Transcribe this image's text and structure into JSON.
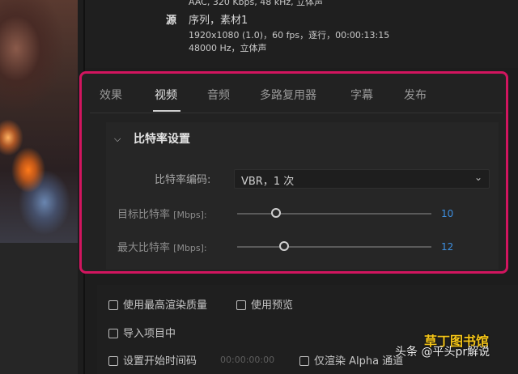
{
  "info": {
    "audio_top": "AAC, 320 Kbps, 48 kHz, 立体声",
    "source_prefix": "源",
    "source_name": "序列，素材1",
    "video_line": "1920x1080 (1.0)，60 fps，逐行，00:00:13:15",
    "audio_line": "48000 Hz，立体声"
  },
  "tabs": [
    {
      "label": "效果"
    },
    {
      "label": "视频"
    },
    {
      "label": "音频"
    },
    {
      "label": "多路复用器"
    },
    {
      "label": "字幕"
    },
    {
      "label": "发布"
    }
  ],
  "active_tab": "视频",
  "bitrate": {
    "section_title": "比特率设置",
    "encoding_label": "比特率编码:",
    "encoding_value": "VBR，1 次",
    "target_label": "目标比特率",
    "target_unit": "[Mbps]:",
    "target_value": "10",
    "target_level": 0.2,
    "max_label": "最大比特率",
    "max_unit": "[Mbps]:",
    "max_value": "12",
    "max_level": 0.24
  },
  "options": {
    "max_quality": "使用最高渲染质量",
    "use_preview": "使用预览",
    "import_project": "导入项目中",
    "set_start_timecode": "设置开始时间码",
    "start_timecode": "00:00:00:00",
    "render_alpha": "仅渲染 Alpha 通道"
  },
  "watermark": {
    "text": "头条 @平头pr解说",
    "logo_text": "草丁图书馆"
  }
}
